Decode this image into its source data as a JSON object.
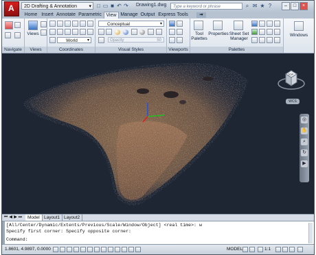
{
  "titlebar": {
    "workspace": "2D Drafting & Annotation",
    "doc_title": "Drawing1.dwg",
    "search_placeholder": "Type a keyword or phrase"
  },
  "tabs": [
    "Home",
    "Insert",
    "Annotate",
    "Parametric",
    "View",
    "Manage",
    "Output",
    "Express Tools"
  ],
  "active_tab": "View",
  "ribbon": {
    "navigate": {
      "title": "Navigate"
    },
    "views": {
      "title": "Views",
      "views_label": "Views"
    },
    "coordinates": {
      "title": "Coordinates",
      "ucs_value": "World"
    },
    "visual_styles": {
      "title": "Visual Styles",
      "style_value": "Conceptual",
      "opacity_label": "Opacity",
      "opacity_value": "50"
    },
    "viewports": {
      "title": "Viewports"
    },
    "palettes": {
      "title": "Palettes",
      "tool_palettes": "Tool Palettes",
      "properties": "Properties",
      "sheet_set_manager": "Sheet Set Manager"
    },
    "windows": {
      "label": "Windows"
    }
  },
  "viewcube": {
    "face": "TOP",
    "wcs": "WCS"
  },
  "layout_tabs": [
    "Model",
    "Layout1",
    "Layout2"
  ],
  "command": {
    "line1": "[All/Center/Dynamic/Extents/Previous/Scale/Window/Object] <real time>: w",
    "line2": "Specify first corner: Specify opposite corner:",
    "prompt": "Command:"
  },
  "status": {
    "coordinates": "1.8601, 4.9897, 0.0000",
    "model": "MODEL",
    "scale": "1:1"
  },
  "colors": {
    "viewport_bg": "#1f2633",
    "ribbon_bg": "#e8edf3",
    "x_axis": "#e02020",
    "y_axis": "#20c020",
    "z_axis": "#2050e0"
  }
}
